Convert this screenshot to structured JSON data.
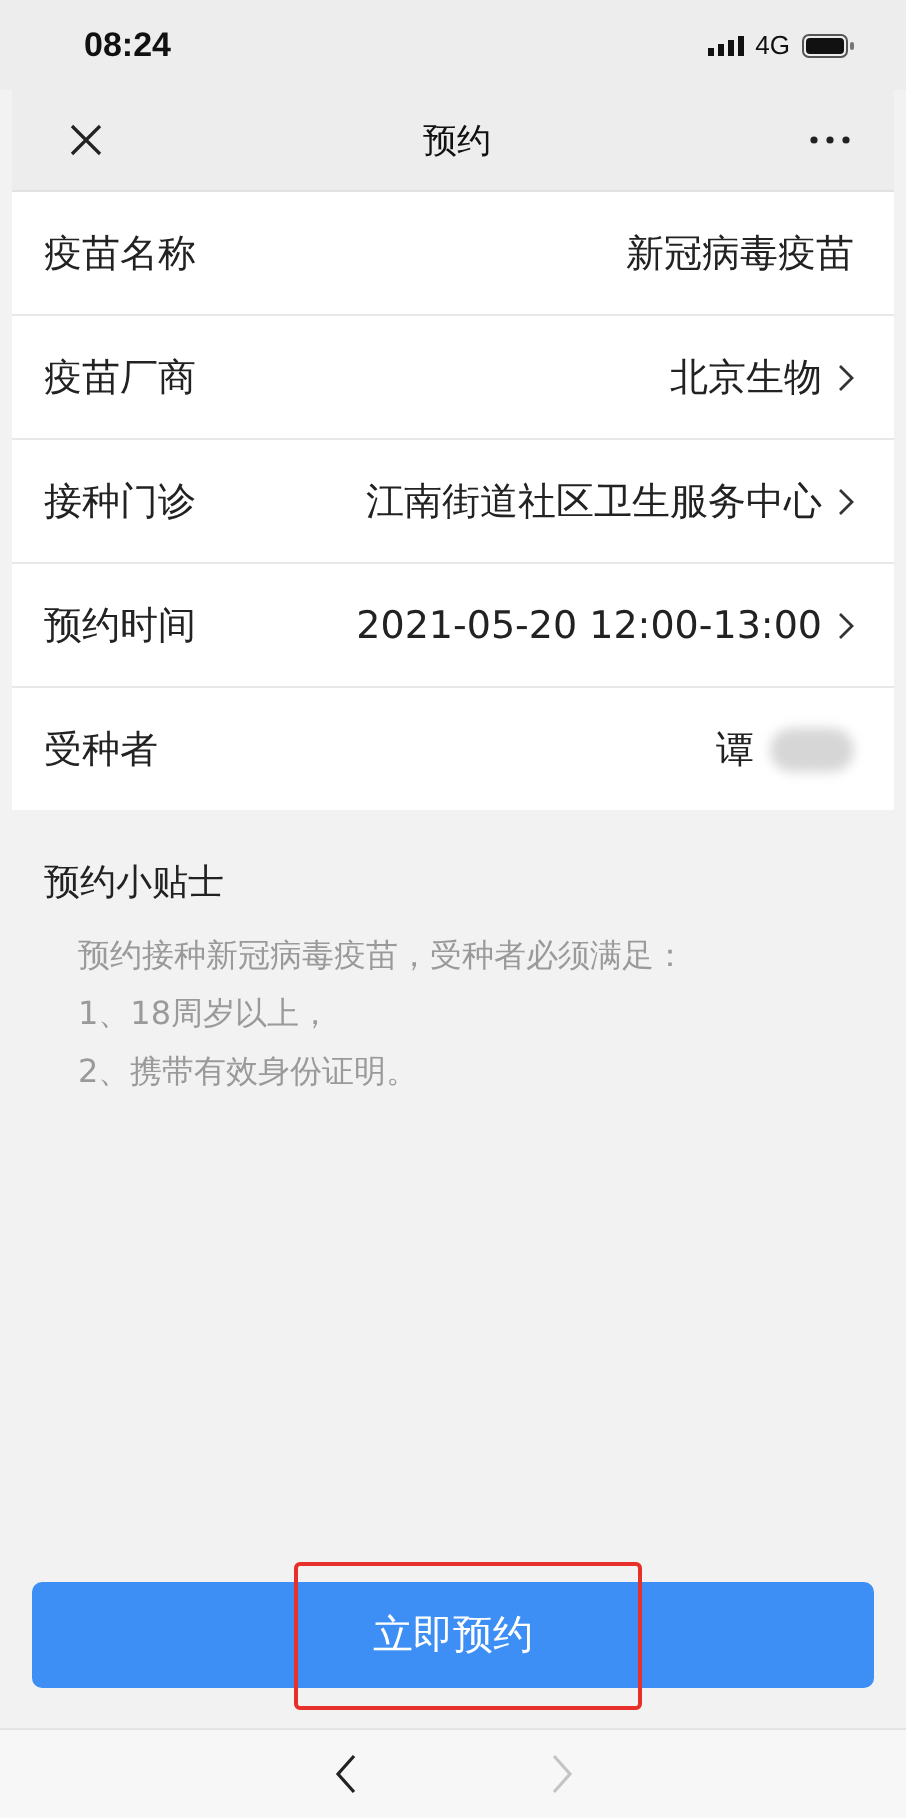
{
  "status_bar": {
    "time": "08:24",
    "network": "4G"
  },
  "nav_bar": {
    "title": "预约"
  },
  "form_rows": [
    {
      "label": "疫苗名称",
      "value": "新冠病毒疫苗",
      "has_arrow": false,
      "masked": false
    },
    {
      "label": "疫苗厂商",
      "value": "北京生物",
      "has_arrow": true,
      "masked": false
    },
    {
      "label": "接种门诊",
      "value": "江南街道社区卫生服务中心",
      "has_arrow": true,
      "masked": false
    },
    {
      "label": "预约时间",
      "value": "2021-05-20 12:00-13:00",
      "has_arrow": true,
      "masked": false
    },
    {
      "label": "受种者",
      "value": "谭",
      "has_arrow": false,
      "masked": true
    }
  ],
  "tips": {
    "title": "预约小贴士",
    "lines": [
      "预约接种新冠病毒疫苗，受种者必须满足：",
      "1、18周岁以上，",
      "2、携带有效身份证明。"
    ]
  },
  "submit_button": {
    "label": "立即预约",
    "highlighted": true
  },
  "bottom_bar": {
    "back_disabled": false,
    "forward_disabled": true
  }
}
